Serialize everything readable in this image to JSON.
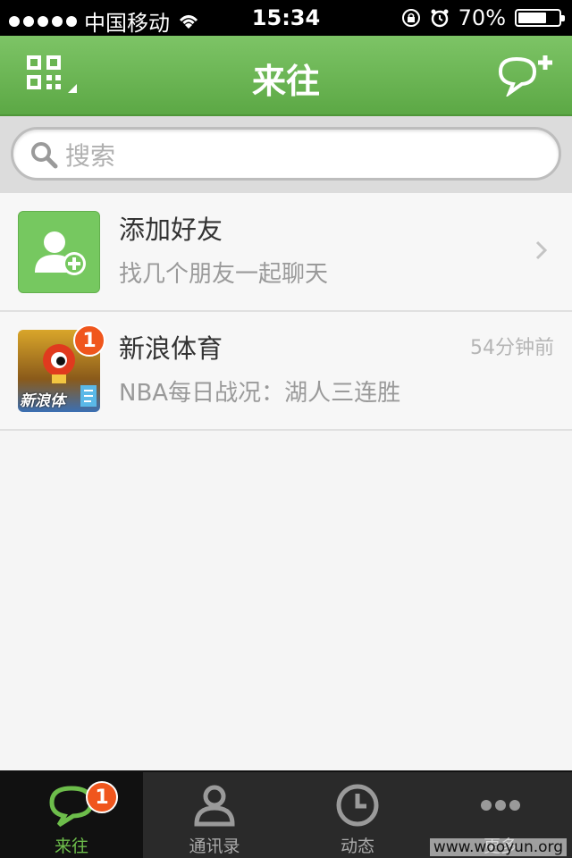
{
  "status_bar": {
    "carrier": "中国移动",
    "time": "15:34",
    "battery": "70%",
    "battery_level": 0.7,
    "icons": [
      "signal-dots-icon",
      "wifi-icon",
      "rotation-lock-icon",
      "alarm-icon",
      "battery-icon"
    ]
  },
  "nav": {
    "title": "来往",
    "left_icon": "qr-code-icon",
    "right_icon": "new-chat-icon"
  },
  "search": {
    "placeholder": "搜索"
  },
  "conversations": [
    {
      "name": "添加好友",
      "subtitle": "找几个朋友一起聊天",
      "time": "",
      "badge": "",
      "icon": "add-friend-icon"
    },
    {
      "name": "新浪体育",
      "subtitle": "NBA每日战况：湖人三连胜",
      "time": "54分钟前",
      "badge": "1",
      "avatar_text": "新浪体"
    }
  ],
  "tabs": [
    {
      "label": "来往",
      "icon": "chat-bubble-icon",
      "badge": "1",
      "active": true
    },
    {
      "label": "通讯录",
      "icon": "contacts-icon",
      "badge": "",
      "active": false
    },
    {
      "label": "动态",
      "icon": "clock-icon",
      "badge": "",
      "active": false
    },
    {
      "label": "更多",
      "icon": "more-icon",
      "badge": "",
      "active": false
    }
  ],
  "watermark": "www.wooyun.org",
  "colors": {
    "nav_green": "#6ab552",
    "tab_active_green": "#6dbd4b",
    "badge_orange": "#f0561d"
  }
}
